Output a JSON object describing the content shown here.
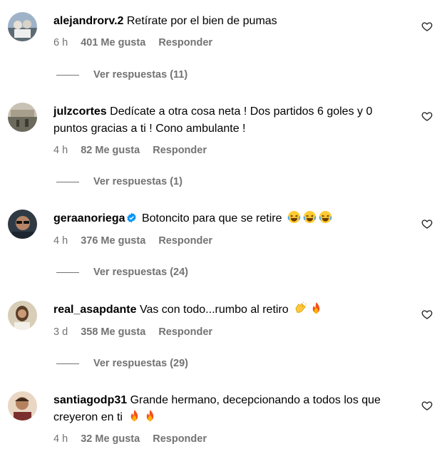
{
  "comments": [
    {
      "username": "alejandrorv.2",
      "text": "Retírate por el bien de pumas",
      "time": "6 h",
      "likes": "401 Me gusta",
      "reply": "Responder",
      "view_replies": "Ver respuestas (11)",
      "verified": false,
      "avatar_icon": "avatar-photo-group",
      "emojis": []
    },
    {
      "username": "julzcortes",
      "text": "Dedícate a otra cosa neta ! Dos partidos 6 goles y 0 puntos gracias a ti ! Cono ambulante !",
      "time": "4 h",
      "likes": "82 Me gusta",
      "reply": "Responder",
      "view_replies": "Ver respuestas (1)",
      "verified": false,
      "avatar_icon": "avatar-photo-landscape",
      "emojis": []
    },
    {
      "username": "geraanoriega",
      "text": "Botoncito para que se retire",
      "time": "4 h",
      "likes": "376 Me gusta",
      "reply": "Responder",
      "view_replies": "Ver respuestas (24)",
      "verified": true,
      "avatar_icon": "avatar-photo-man-glasses",
      "emojis": [
        "laughing-emoji",
        "laughing-emoji",
        "laughing-emoji"
      ]
    },
    {
      "username": "real_asapdante",
      "text": "Vas con todo...rumbo al retiro",
      "time": "3 d",
      "likes": "358 Me gusta",
      "reply": "Responder",
      "view_replies": "Ver respuestas (29)",
      "verified": false,
      "avatar_icon": "avatar-photo-person",
      "emojis": [
        "clapping-hands-emoji",
        "fire-emoji"
      ]
    },
    {
      "username": "santiagodp31",
      "text": "Grande hermano, decepcionando a todos los que creyeron en ti",
      "time": "4 h",
      "likes": "32 Me gusta",
      "reply": "Responder",
      "verified": false,
      "avatar_icon": "avatar-photo-person-dark",
      "emojis": [
        "fire-emoji",
        "fire-emoji"
      ]
    }
  ],
  "colors": {
    "text": "#000000",
    "meta": "#737373",
    "verified": "#0095f6"
  },
  "icons": {
    "like": "heart-outline-icon",
    "verified": "verified-badge-icon"
  }
}
